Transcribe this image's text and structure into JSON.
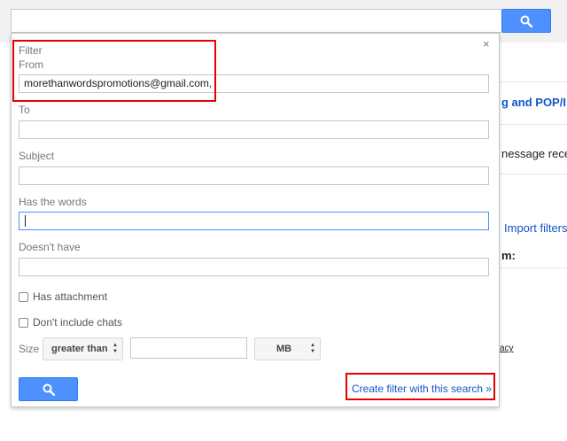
{
  "search_bar": {
    "value": "",
    "icon": "search-icon"
  },
  "background": {
    "forwarding_link": "g and POP/I",
    "message_text": "nessage recei",
    "import_filters": "Import filters",
    "bold_text": "m:",
    "small_text": "acy"
  },
  "filter": {
    "title": "Filter",
    "close_label": "×",
    "from": {
      "label": "From",
      "value": "morethanwordspromotions@gmail.com,"
    },
    "to": {
      "label": "To",
      "value": ""
    },
    "subject": {
      "label": "Subject",
      "value": ""
    },
    "has_words": {
      "label": "Has the words",
      "value": ""
    },
    "doesnt_have": {
      "label": "Doesn't have",
      "value": ""
    },
    "has_attachment": {
      "label": "Has attachment",
      "checked": false
    },
    "dont_include_chats": {
      "label": "Don't include chats",
      "checked": false
    },
    "size": {
      "label": "Size",
      "operator": "greater than",
      "value": "",
      "unit": "MB"
    },
    "create_filter_link": "Create filter with this search »"
  },
  "colors": {
    "accent_blue": "#4d90fe",
    "link_blue": "#1155cc",
    "annotation_red": "#e60000"
  }
}
